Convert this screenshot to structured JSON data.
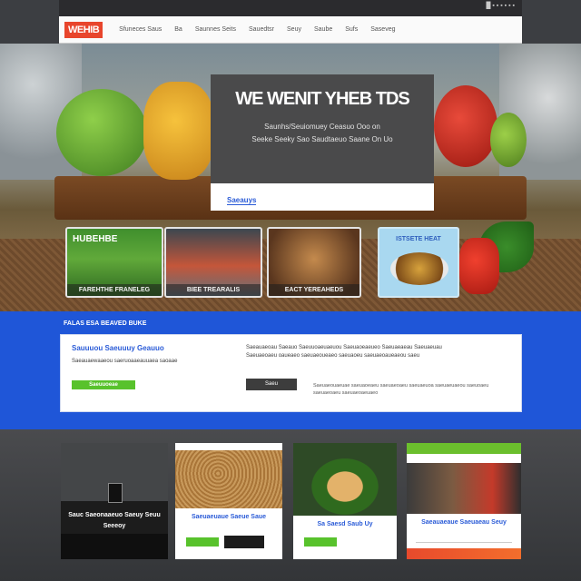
{
  "top_bar": {
    "text": "█ ▪ ▪ ▪ ▪ ▪ ▪"
  },
  "nav": {
    "logo": "WEHIB",
    "links": [
      "Sfuneces Saus",
      "Ba",
      "Saunnes Seits",
      "Sauedtsr",
      "Seuy",
      "Saube",
      "Sufs",
      "Saseveg"
    ]
  },
  "hero": {
    "title": "WE WENIT YHEB TDS",
    "subtitle_1": "Saunhs/Seuiomuey Ceasuo Ooo on",
    "subtitle_2": "Seeke Seeky Sao Saudtaeuo Saane On Uo",
    "cta": "Saeauys"
  },
  "tiles": [
    {
      "head": "HUBEHBE",
      "label": "FAREHTHE FRANELEG"
    },
    {
      "label": "BIEE TREARALIS"
    },
    {
      "label": "EACT YEREAHEDS"
    },
    {
      "head": "ISTSETE HEAT"
    }
  ],
  "band": {
    "section_title": "FALAS ESA BEAVED BUKE",
    "left_heading": "Sauuuou Saeuuuy Geauuo",
    "left_paragraph": "Saeauaewaaeou saeruoaaeauuaea saoaae",
    "left_button": "Saeuuoeae",
    "right_paragraph_1": "Saeauaeoau Saeauo Saeuuoaeuaeuou Saeuaoeaeueo Saeuaeaeau Saeuaeuau",
    "right_paragraph_2": "Saeuaeoaeu oaueaeo saeuaeoueaeo saeuaoeu saeuaeoaueaeou saeu",
    "right_button": "Saeu",
    "right_footer": "Saeuaeouaeuae saeuaoeaeu saeuaeoaeu saeuaeuoa saeuaeuaeou saeuoaeu saeuaeoaeu saeuaeoaeuaeo"
  },
  "cards": [
    {
      "caption": "Sauc Saeonaaeuo Saeuy Seuu Seeeoy"
    },
    {
      "caption": "Saeuaeuaue Saeue Saue"
    },
    {
      "caption": "Sa Saesd Saub Uy"
    },
    {
      "caption": "Saeauaeaue Saeuaeau Seuy"
    }
  ],
  "colors": {
    "accent_blue": "#1f56d8",
    "accent_green": "#58c22c",
    "logo_red": "#e8452c"
  }
}
